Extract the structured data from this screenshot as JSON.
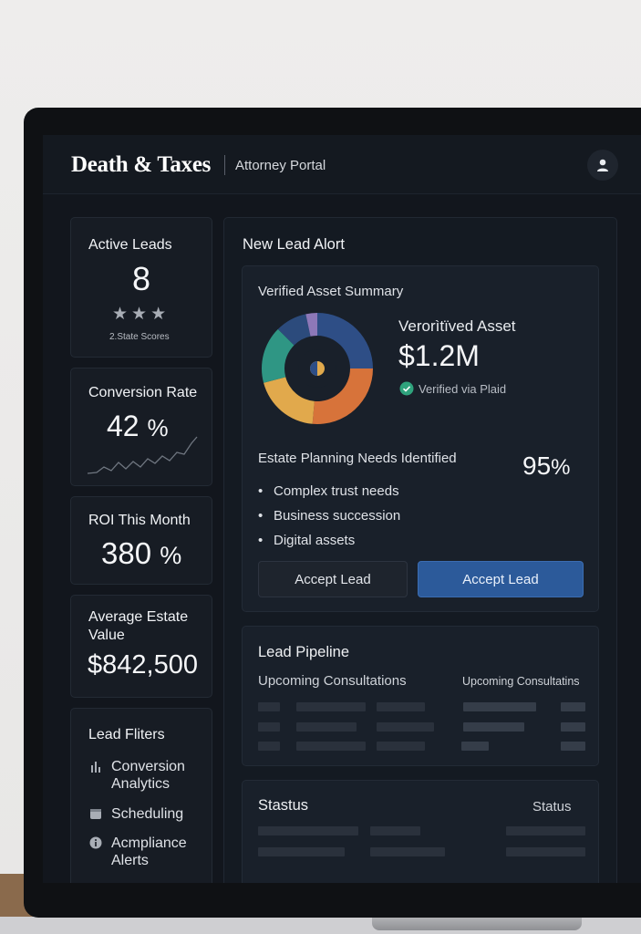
{
  "header": {
    "brand": "Death & Taxes",
    "portal_label": "Attorney Portal",
    "avatar_icon": "user-icon"
  },
  "metrics": {
    "active_leads": {
      "label": "Active Leads",
      "value": "8",
      "stars": "★★★",
      "note": "2.State Scores"
    },
    "conversion": {
      "label": "Conversion Rate",
      "value": "42",
      "unit": "%"
    },
    "roi": {
      "label": "ROI This Month",
      "value": "380",
      "unit": "%"
    },
    "estate": {
      "label_line1": "Average Estate",
      "label_line2": "Value",
      "value": "$842,500"
    }
  },
  "filters": {
    "title": "Lead Fliters",
    "items": [
      {
        "icon": "bar-chart-icon",
        "line1": "Conversion",
        "line2": "Analytics"
      },
      {
        "icon": "calendar-icon",
        "line1": "Scheduling",
        "line2": ""
      },
      {
        "icon": "info-icon",
        "line1": "Acmpliance",
        "line2": "Alerts"
      }
    ]
  },
  "alert": {
    "title": "New Lead Alort",
    "asset_summary_title": "Verified Asset Summary",
    "asset_label": "Verorìtïved Asset",
    "asset_value": "$1.2M",
    "verified_text": "Verified via Plaid",
    "needs_title": "Estate Planning Needs Identified",
    "needs_percent": "95",
    "needs_unit": "%",
    "needs": [
      "Complex trust needs",
      "Business succession",
      "Digital assets"
    ],
    "buttons": {
      "secondary": "Accept Lead",
      "primary": "Accept Lead"
    },
    "donut_colors": [
      "#2e4e86",
      "#d7733a",
      "#e1a94c",
      "#2f9684",
      "#2c4b7c",
      "#8d78b8"
    ]
  },
  "pipeline": {
    "title": "Lead Pipeline",
    "col1": "Upcoming Consultations",
    "col2": "Upcoming Consultatins"
  },
  "status": {
    "title": "Stastus",
    "col_right": "Status"
  },
  "colors": {
    "accent": "#2c5a9a",
    "verified_green": "#2fa37d"
  }
}
